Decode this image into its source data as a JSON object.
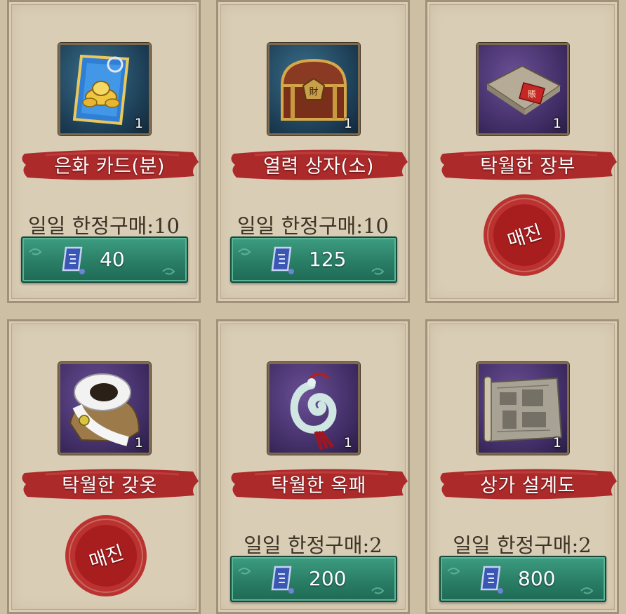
{
  "currency_icon": "blue-jade-token-icon",
  "items": [
    {
      "name": "은화 카드(분)",
      "icon": "silver-card-icon",
      "quantity": "1",
      "limit": "일일 한정구매:10",
      "price": "40",
      "sold_out": null
    },
    {
      "name": "열력 상자(소)",
      "icon": "treasure-chest-icon",
      "quantity": "1",
      "limit": "일일 한정구매:10",
      "price": "125",
      "sold_out": null
    },
    {
      "name": "탁월한 장부",
      "icon": "ledger-book-icon",
      "quantity": "1",
      "limit": null,
      "price": null,
      "sold_out": "매진"
    },
    {
      "name": "탁월한 갖옷",
      "icon": "fur-coat-icon",
      "quantity": "1",
      "limit": null,
      "price": null,
      "sold_out": "매진"
    },
    {
      "name": "탁월한 옥패",
      "icon": "jade-pendant-icon",
      "quantity": "1",
      "limit": "일일 한정구매:2",
      "price": "200",
      "sold_out": null
    },
    {
      "name": "상가 설계도",
      "icon": "blueprint-scroll-icon",
      "quantity": "1",
      "limit": "일일 한정구매:2",
      "price": "800",
      "sold_out": null
    }
  ],
  "colors": {
    "panel": "#d9cdb5",
    "banner_red": "#b02b2c",
    "button_green": "#2a7e66",
    "stamp_red": "#b82525"
  }
}
